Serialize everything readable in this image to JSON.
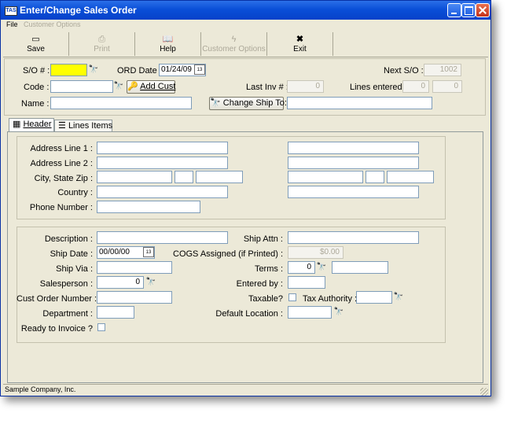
{
  "window": {
    "title": "Enter/Change Sales Order",
    "icon_label": "TAS"
  },
  "menu": {
    "file": "File",
    "customer_options": "Customer Options"
  },
  "toolbar": {
    "save": "Save",
    "print": "Print",
    "help": "Help",
    "customer_options": "Customer Options",
    "exit": "Exit"
  },
  "header_form": {
    "so_label": "S/O # :",
    "so_value": "",
    "ord_date_label": "ORD Date :",
    "ord_date_value": "01/24/09",
    "next_so_label": "Next S/O :",
    "next_so_value": "1002",
    "code_label": "Code :",
    "code_value": "",
    "add_cust_label": "Add Cust",
    "last_inv_label": "Last Inv # :",
    "last_inv_value": "0",
    "lines_entered_label": "Lines entered :",
    "lines_entered_value1": "0",
    "lines_entered_value2": "0",
    "name_label": "Name :",
    "name_value": "",
    "change_ship_label": "Change Ship To:",
    "change_ship_value": ""
  },
  "tabs": {
    "header": "Header",
    "line_items": "Lines Items"
  },
  "address": {
    "line1_label": "Address Line 1 :",
    "line2_label": "Address Line 2 :",
    "city_label": "City, State Zip :",
    "country_label": "Country :",
    "phone_label": "Phone Number :"
  },
  "details": {
    "description_label": "Description :",
    "ship_attn_label": "Ship Attn :",
    "ship_date_label": "Ship Date :",
    "ship_date_value": "00/00/00",
    "cogs_label": "COGS Assigned (if Printed) :",
    "cogs_value": "$0.00",
    "ship_via_label": "Ship Via :",
    "terms_label": "Terms :",
    "terms_value": "0",
    "salesperson_label": "Salesperson :",
    "salesperson_value": "0",
    "entered_by_label": "Entered by :",
    "cust_order_label": "Cust Order Number :",
    "taxable_label": "Taxable?",
    "tax_authority_label": "Tax Authority :",
    "department_label": "Department :",
    "default_location_label": "Default Location :",
    "ready_to_invoice_label": "Ready to Invoice ?"
  },
  "status": {
    "company": "Sample Company, Inc."
  },
  "icons": {
    "lookup": "binoculars-icon",
    "calendar": "calendar-icon",
    "add": "key-icon",
    "save": "floppy-icon",
    "print": "printer-icon",
    "help": "book-icon",
    "exit": "x-icon"
  }
}
